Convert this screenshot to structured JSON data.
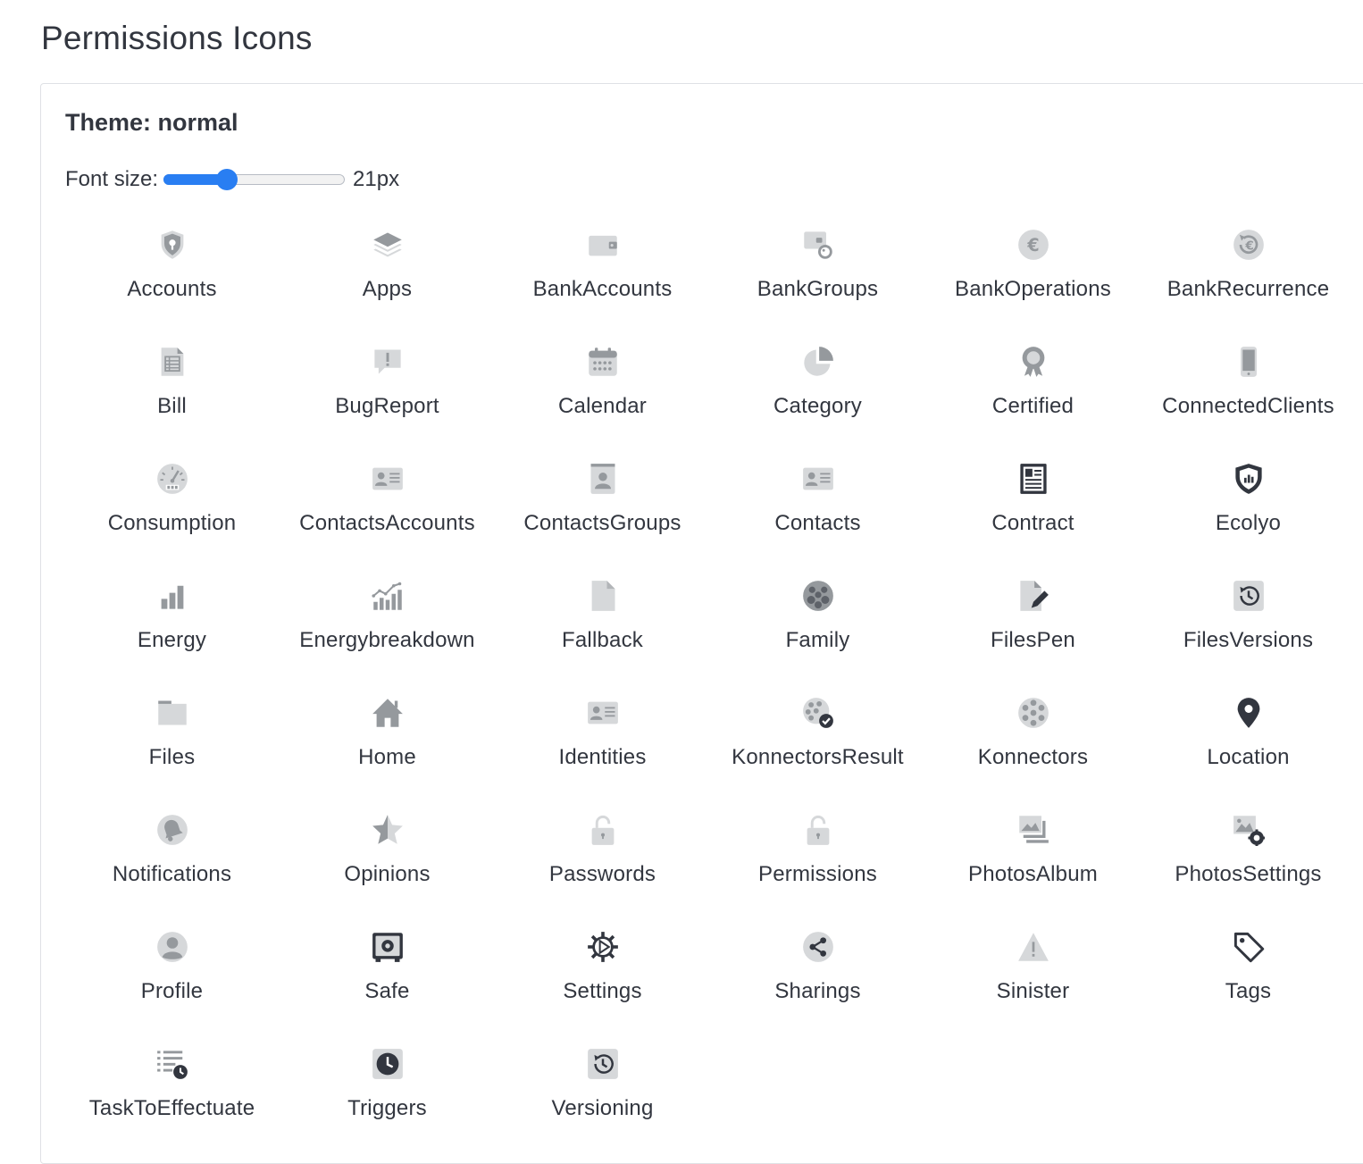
{
  "page": {
    "title": "Permissions Icons"
  },
  "panel": {
    "theme_title": "Theme: normal",
    "font_size_label": "Font size:",
    "font_size_value": "21px",
    "slider_fraction": 0.35
  },
  "colors": {
    "accent": "#297ef2",
    "icon_gray": "#95999d",
    "icon_light": "#d6d8da",
    "icon_dark": "#32363f",
    "text": "#32363f"
  },
  "icons": [
    {
      "label": "Accounts",
      "icon": "shield-keyhole-icon"
    },
    {
      "label": "Apps",
      "icon": "stacked-layers-icon"
    },
    {
      "label": "BankAccounts",
      "icon": "wallet-icon"
    },
    {
      "label": "BankGroups",
      "icon": "bank-tag-icon"
    },
    {
      "label": "BankOperations",
      "icon": "euro-coin-icon"
    },
    {
      "label": "BankRecurrence",
      "icon": "euro-recurrence-icon"
    },
    {
      "label": "Bill",
      "icon": "bill-icon"
    },
    {
      "label": "BugReport",
      "icon": "speech-exclamation-icon"
    },
    {
      "label": "Calendar",
      "icon": "calendar-icon"
    },
    {
      "label": "Category",
      "icon": "pie-chart-icon"
    },
    {
      "label": "Certified",
      "icon": "ribbon-badge-icon"
    },
    {
      "label": "ConnectedClients",
      "icon": "mobile-phone-icon"
    },
    {
      "label": "Consumption",
      "icon": "gauge-meter-icon"
    },
    {
      "label": "ContactsAccounts",
      "icon": "contact-card-icon"
    },
    {
      "label": "ContactsGroups",
      "icon": "contact-book-icon"
    },
    {
      "label": "Contacts",
      "icon": "contact-card-icon"
    },
    {
      "label": "Contract",
      "icon": "contract-document-icon"
    },
    {
      "label": "Ecolyo",
      "icon": "shield-bars-icon"
    },
    {
      "label": "Energy",
      "icon": "bar-chart-icon"
    },
    {
      "label": "Energybreakdown",
      "icon": "trend-bars-icon"
    },
    {
      "label": "Fallback",
      "icon": "blank-file-icon"
    },
    {
      "label": "Family",
      "icon": "family-group-icon"
    },
    {
      "label": "FilesPen",
      "icon": "file-pen-icon"
    },
    {
      "label": "FilesVersions",
      "icon": "history-clock-icon"
    },
    {
      "label": "Files",
      "icon": "folder-icon"
    },
    {
      "label": "Home",
      "icon": "house-icon"
    },
    {
      "label": "Identities",
      "icon": "contact-card-icon"
    },
    {
      "label": "KonnectorsResult",
      "icon": "konnector-check-icon"
    },
    {
      "label": "Konnectors",
      "icon": "konnector-dots-icon"
    },
    {
      "label": "Location",
      "icon": "map-pin-icon"
    },
    {
      "label": "Notifications",
      "icon": "bell-icon"
    },
    {
      "label": "Opinions",
      "icon": "half-star-icon"
    },
    {
      "label": "Passwords",
      "icon": "padlock-icon"
    },
    {
      "label": "Permissions",
      "icon": "padlock-icon"
    },
    {
      "label": "PhotosAlbum",
      "icon": "photo-stack-icon"
    },
    {
      "label": "PhotosSettings",
      "icon": "photo-gear-icon"
    },
    {
      "label": "Profile",
      "icon": "user-circle-icon"
    },
    {
      "label": "Safe",
      "icon": "safe-vault-icon"
    },
    {
      "label": "Settings",
      "icon": "gear-icon"
    },
    {
      "label": "Sharings",
      "icon": "share-icon"
    },
    {
      "label": "Sinister",
      "icon": "warning-triangle-icon"
    },
    {
      "label": "Tags",
      "icon": "tag-icon"
    },
    {
      "label": "TaskToEffectuate",
      "icon": "task-list-clock-icon"
    },
    {
      "label": "Triggers",
      "icon": "clock-square-icon"
    },
    {
      "label": "Versioning",
      "icon": "history-clock-icon"
    }
  ]
}
